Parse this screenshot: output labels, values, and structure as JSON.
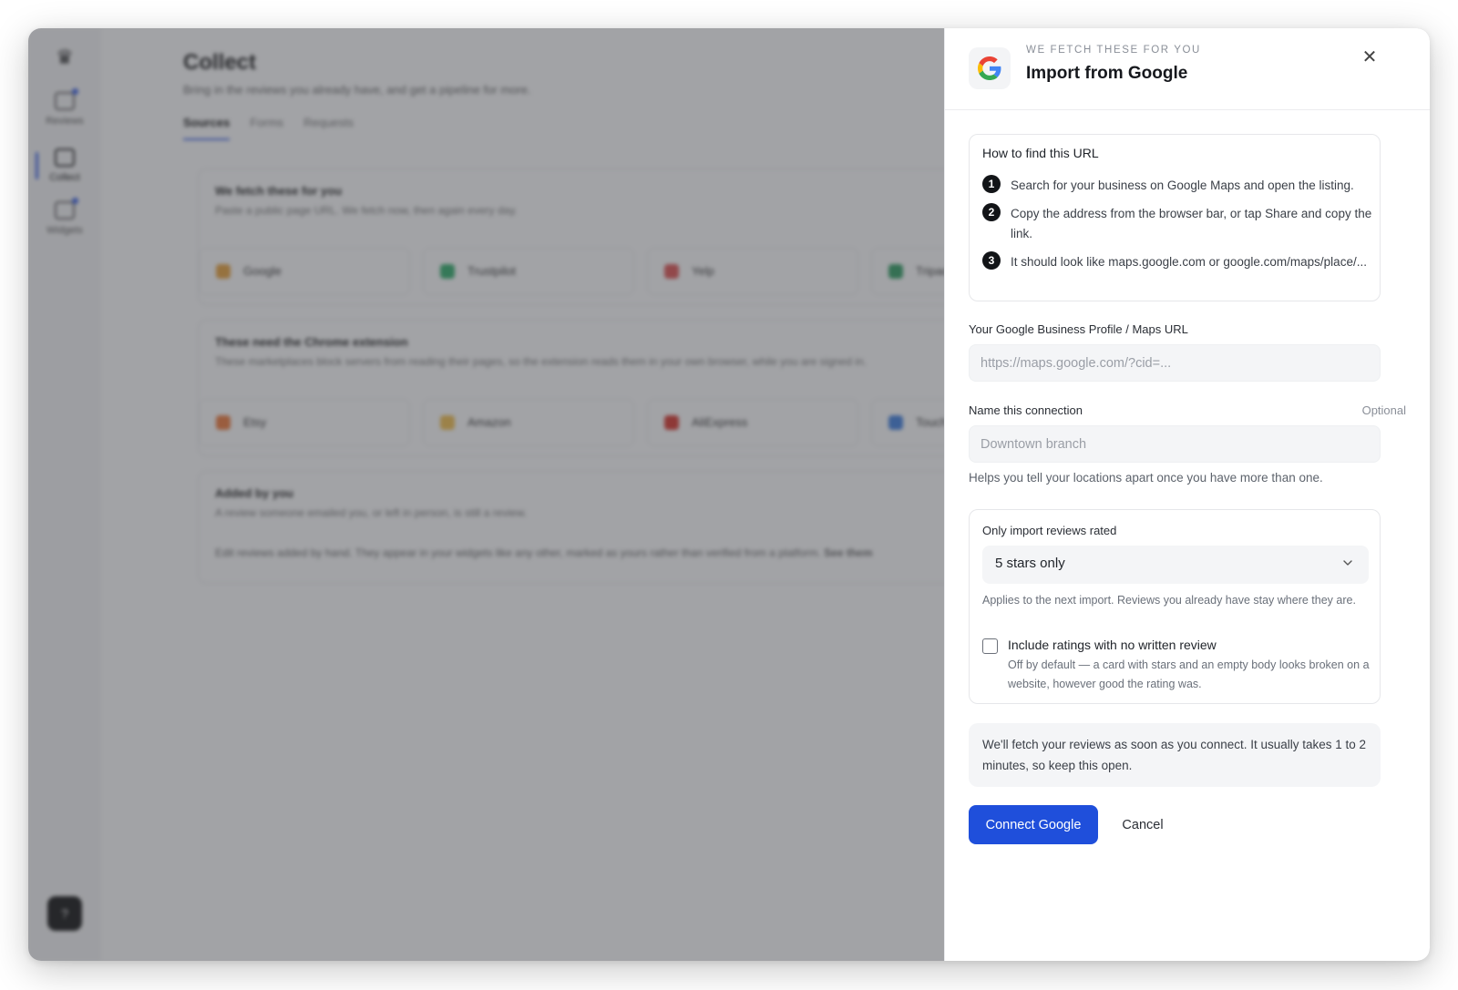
{
  "background": {
    "rail": {
      "items": [
        {
          "label": "Reviews"
        },
        {
          "label": "Collect"
        },
        {
          "label": "Widgets"
        }
      ],
      "help_label": "?"
    },
    "page": {
      "title": "Collect",
      "subtitle": "Bring in the reviews you already have, and get a pipeline for more.",
      "tabs": [
        "Sources",
        "Forms",
        "Requests"
      ],
      "fetched": {
        "title": "We fetch these for you",
        "desc": "Paste a public page URL. We fetch now, then again every day.",
        "tiles": [
          "Google",
          "Trustpilot",
          "Yelp",
          "Tripadvisor"
        ]
      },
      "extension": {
        "title": "These need the Chrome extension",
        "desc": "These marketplaces block servers from reading their pages, so the extension reads them in your own browser, while you are signed in.",
        "tiles": [
          "Etsy",
          "Amazon",
          "AliExpress",
          "Touch"
        ]
      },
      "manual": {
        "title": "Added by you",
        "desc": "A review someone emailed you, or left in person, is still a review.",
        "note": "Edit reviews added by hand. They appear in your widgets like any other, marked as yours rather than verified from a platform.",
        "link": "See them"
      }
    }
  },
  "drawer": {
    "eyebrow": "WE FETCH THESE FOR YOU",
    "title": "Import from Google",
    "close_label": "✕",
    "howto": {
      "title": "How to find this URL",
      "steps": [
        {
          "num": "1",
          "text": "Search for your business on Google Maps and open the listing."
        },
        {
          "num": "2",
          "text": "Copy the address from the browser bar, or tap Share and copy the link."
        },
        {
          "num": "3",
          "text": "It should look like maps.google.com or google.com/maps/place/..."
        }
      ]
    },
    "url_field": {
      "label": "Your Google Business Profile / Maps URL",
      "placeholder": "https://maps.google.com/?cid=...",
      "value": ""
    },
    "name_field": {
      "label": "Name this connection",
      "optional_label": "Optional",
      "placeholder": "Downtown branch",
      "value": "",
      "help": "Helps you tell your locations apart once you have more than one."
    },
    "filter": {
      "label": "Only import reviews rated",
      "selected": "5 stars only",
      "applies_note": "Applies to the next import. Reviews you already have stay where they are.",
      "checkbox_label": "Include ratings with no written review",
      "checkbox_checked": false,
      "checkbox_help": "Off by default — a card with stars and an empty body looks broken on a website, however good the rating was."
    },
    "info": "We'll fetch your reviews as soon as you connect. It usually takes 1 to 2 minutes, so keep this open.",
    "actions": {
      "connect_label": "Connect Google",
      "cancel_label": "Cancel"
    }
  },
  "colors": {
    "primary": "#1f4fdb",
    "accent": "#3b62e8",
    "step_badge": "#121417"
  }
}
